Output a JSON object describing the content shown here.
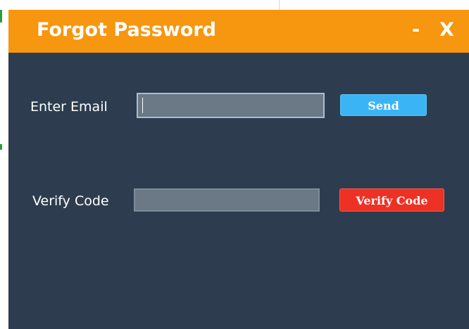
{
  "window": {
    "title": "Forgot Password",
    "minimize_label": "-",
    "close_label": "X"
  },
  "email": {
    "label": "Enter Email",
    "value": "",
    "send_label": "Send"
  },
  "verify": {
    "label": "Verify Code",
    "value": "",
    "button_label": "Verify Code"
  },
  "colors": {
    "titlebar": "#f7960f",
    "body": "#2d3d4f",
    "input_fill": "#6b7886",
    "send_button": "#3bb4f5",
    "verify_button": "#ee3125"
  }
}
